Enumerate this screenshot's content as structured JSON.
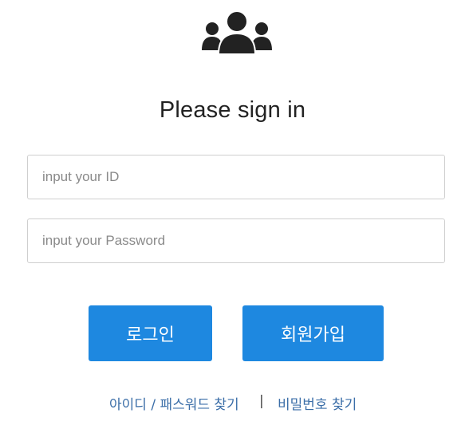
{
  "header": {
    "icon": "users-group-icon",
    "title": "Please sign in"
  },
  "form": {
    "id_placeholder": "input your ID",
    "password_placeholder": "input your Password"
  },
  "buttons": {
    "login_label": "로그인",
    "signup_label": "회원가입"
  },
  "links": {
    "find_id_label": "아이디 / 패스워드 찾기",
    "separator": "|",
    "find_password_label": "비밀번호 찾기"
  },
  "colors": {
    "primary": "#1e88e0",
    "link": "#3b6ea8",
    "icon": "#222222"
  }
}
